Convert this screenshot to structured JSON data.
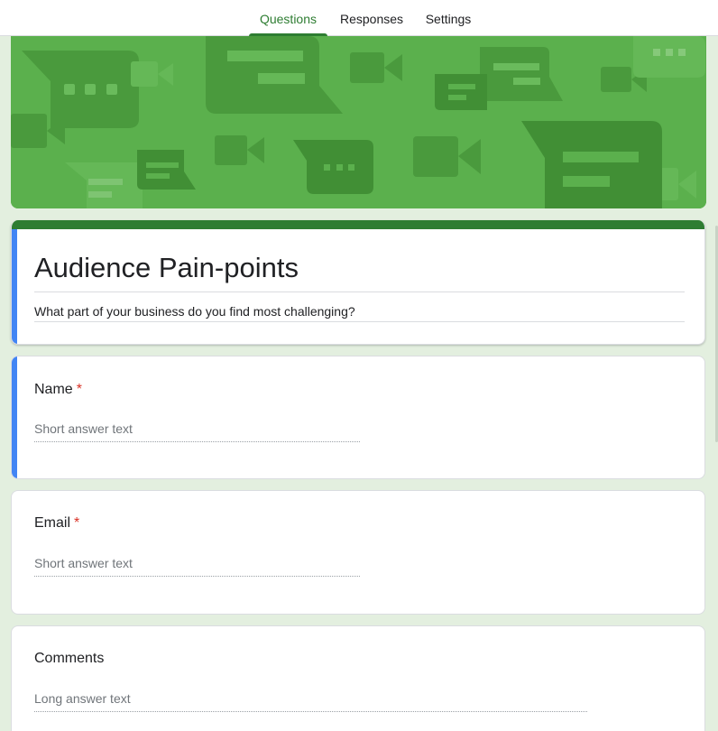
{
  "tabs": [
    {
      "label": "Questions",
      "active": true
    },
    {
      "label": "Responses",
      "active": false
    },
    {
      "label": "Settings",
      "active": false
    }
  ],
  "theme": {
    "accent": "#2e7d32",
    "banner": "#5bb04d",
    "focus_bar": "#4285f4",
    "required": "#d93025",
    "background": "#e3efdf"
  },
  "form": {
    "title": "Audience Pain-points",
    "description": "What part of your business do you find most challenging?"
  },
  "questions": [
    {
      "label": "Name",
      "required_mark": "*",
      "placeholder": "Short answer text"
    },
    {
      "label": "Email",
      "required_mark": "*",
      "placeholder": "Short answer text"
    },
    {
      "label": "Comments",
      "placeholder": "Long answer text"
    }
  ]
}
